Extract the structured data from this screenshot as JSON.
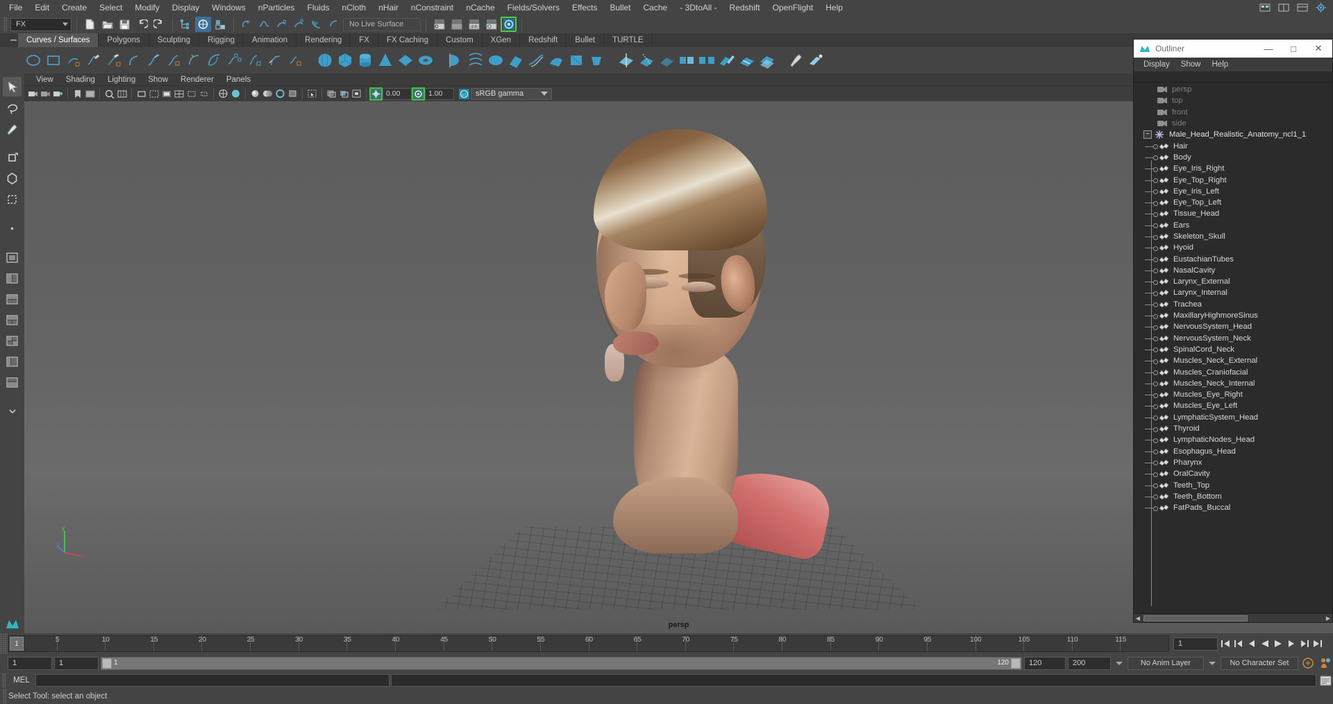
{
  "menubar": {
    "items": [
      "File",
      "Edit",
      "Create",
      "Select",
      "Modify",
      "Display",
      "Windows",
      "nParticles",
      "Fluids",
      "nCloth",
      "nHair",
      "nConstraint",
      "nCache",
      "Fields/Solvers",
      "Effects",
      "Bullet",
      "Cache",
      "- 3DtoAll -",
      "Redshift",
      "OpenFlight",
      "Help"
    ]
  },
  "statusline": {
    "menuset": "FX",
    "no_live_surface": "No Live Surface",
    "icons": [
      "new-scene-icon",
      "open-scene-icon",
      "save-scene-icon",
      "undo-icon",
      "redo-icon",
      "select-by-hierarchy-icon",
      "select-by-object-icon",
      "select-by-component-icon",
      "snap-to-grid-icon",
      "snap-to-curve-icon",
      "snap-to-point-icon",
      "snap-to-projected-center-icon",
      "snap-to-view-plane-icon",
      "make-live-icon",
      "render-current-frame-icon",
      "ipr-render-icon",
      "render-settings-icon",
      "hypershade-icon",
      "render-view-icon"
    ]
  },
  "shelf": {
    "tabs": [
      "Curves / Surfaces",
      "Polygons",
      "Sculpting",
      "Rigging",
      "Animation",
      "Rendering",
      "FX",
      "FX Caching",
      "Custom",
      "XGen",
      "Redshift",
      "Bullet",
      "TURTLE"
    ],
    "active_tab": "Curves / Surfaces",
    "icons": [
      "nurbs-circle-icon",
      "nurbs-square-icon",
      "nurbs-square-options-icon",
      "pencil-curve-icon",
      "pencil-curve-options-icon",
      "ep-curve-icon",
      "bezier-curve-icon",
      "bezier-options-icon",
      "arc-curve-icon",
      "two-point-arc-icon",
      "attach-curve-icon",
      "detach-curve-icon",
      "offset-curve-icon",
      "curve-fillet-icon",
      "nurbs-sphere-icon",
      "nurbs-cube-icon",
      "nurbs-cylinder-icon",
      "nurbs-cone-icon",
      "nurbs-plane-icon",
      "nurbs-torus-icon",
      "revolve-icon",
      "loft-icon",
      "planar-icon",
      "extrude-icon",
      "birail-icon",
      "boundary-icon",
      "square-surface-icon",
      "bevel-icon",
      "intersect-surfaces-icon",
      "trim-tool-icon",
      "untrim-surfaces-icon",
      "attach-surfaces-icon",
      "detach-surfaces-icon",
      "align-surfaces-icon",
      "insert-isoparms-icon",
      "offset-surfaces-icon",
      "sculpt-geometry-icon",
      "surface-editing-icon"
    ]
  },
  "toolbox": {
    "items": [
      "select-tool",
      "lasso-select-tool",
      "paint-select-tool",
      "move-tool",
      "rotate-tool",
      "scale-tool",
      "last-tool-used",
      "single-pane-layout",
      "two-pane-side-layout",
      "two-pane-stacked-layout",
      "three-pane-top-split-layout",
      "three-pane-left-split-layout",
      "four-pane-layout",
      "persp-outliner-layout",
      "persp-graph-layout",
      "hypershade-persp-layout",
      "more-layouts"
    ]
  },
  "viewport": {
    "menus": [
      "View",
      "Shading",
      "Lighting",
      "Show",
      "Renderer",
      "Panels"
    ],
    "camera_label": "persp",
    "toolbar": {
      "exposure_value": "0.00",
      "gamma_value": "1.00",
      "color_management": "sRGB gamma",
      "icons": [
        "select-camera-icon",
        "lock-camera-icon",
        "camera-attributes-icon",
        "bookmark-icon",
        "image-plane-icon",
        "two-d-pan-zoom-icon",
        "grid-toggle-icon",
        "film-gate-icon",
        "resolution-gate-icon",
        "gate-mask-icon",
        "field-chart-icon",
        "safe-action-icon",
        "safe-title-icon",
        "wireframe-icon",
        "smooth-shade-icon",
        "shaded-wireframe-icon",
        "textured-icon",
        "use-all-lights-icon",
        "shadows-icon",
        "screen-space-ao-icon",
        "motion-blur-icon",
        "multisample-icon",
        "depth-of-field-icon",
        "isolate-select-icon",
        "xray-icon",
        "xray-joints-icon",
        "xray-active-components-icon",
        "exposure-icon",
        "gamma-icon",
        "color-management-icon"
      ]
    }
  },
  "outliner": {
    "window_title": "Outliner",
    "window_buttons": [
      "minimize-button",
      "maximize-button",
      "close-button"
    ],
    "menus": [
      "Display",
      "Show",
      "Help"
    ],
    "cameras": [
      "persp",
      "top",
      "front",
      "side"
    ],
    "root": "Male_Head_Realistic_Anatomy_ncl1_1",
    "root_expanded": true,
    "children": [
      "Hair",
      "Body",
      "Eye_Iris_Right",
      "Eye_Top_Right",
      "Eye_Iris_Left",
      "Eye_Top_Left",
      "Tissue_Head",
      "Ears",
      "Skeleton_Skull",
      "Hyoid",
      "EustachianTubes",
      "NasalCavity",
      "Larynx_External",
      "Larynx_Internal",
      "Trachea",
      "MaxillaryHighmoreSinus",
      "NervousSystem_Head",
      "NervousSystem_Neck",
      "SpinalCord_Neck",
      "Muscles_Neck_External",
      "Muscles_Craniofacial",
      "Muscles_Neck_Internal",
      "Muscles_Eye_Right",
      "Muscles_Eye_Left",
      "LymphaticSystem_Head",
      "Thyroid",
      "LymphaticNodes_Head",
      "Esophagus_Head",
      "Pharynx",
      "OralCavity",
      "Teeth_Top",
      "Teeth_Bottom",
      "FatPads_Buccal"
    ]
  },
  "timeslider": {
    "current_frame": "1",
    "ticks": [
      5,
      10,
      15,
      20,
      25,
      30,
      35,
      40,
      45,
      50,
      55,
      60,
      65,
      70,
      75,
      80,
      85,
      90,
      95,
      100,
      105,
      110,
      115
    ],
    "frame_field": "1",
    "playback_buttons": [
      "go-to-start-icon",
      "step-back-key-icon",
      "step-back-frame-icon",
      "play-backwards-icon",
      "play-forwards-icon",
      "step-forward-frame-icon",
      "step-forward-key-icon",
      "go-to-end-icon"
    ]
  },
  "rangeslider": {
    "start_field": "1",
    "current_field": "1",
    "range_start_label": "1",
    "range_end_label": "120",
    "range_end_field": "120",
    "playback_end_field": "200",
    "anim_layer": "No Anim Layer",
    "character_set": "No Character Set",
    "icons": [
      "auto-keyframe-icon",
      "animation-preferences-icon"
    ]
  },
  "command": {
    "label": "MEL",
    "input_value": ""
  },
  "status": {
    "message": "Select Tool: select an object"
  },
  "colors": {
    "bg": "#444444",
    "panel": "#3c3c3c",
    "outliner_bg": "#2b2b2b",
    "accent_blue": "#3f6f96",
    "accent_green": "#4ad04a",
    "icon_blue": "#4d9ec4",
    "text": "#c8c8c8"
  }
}
